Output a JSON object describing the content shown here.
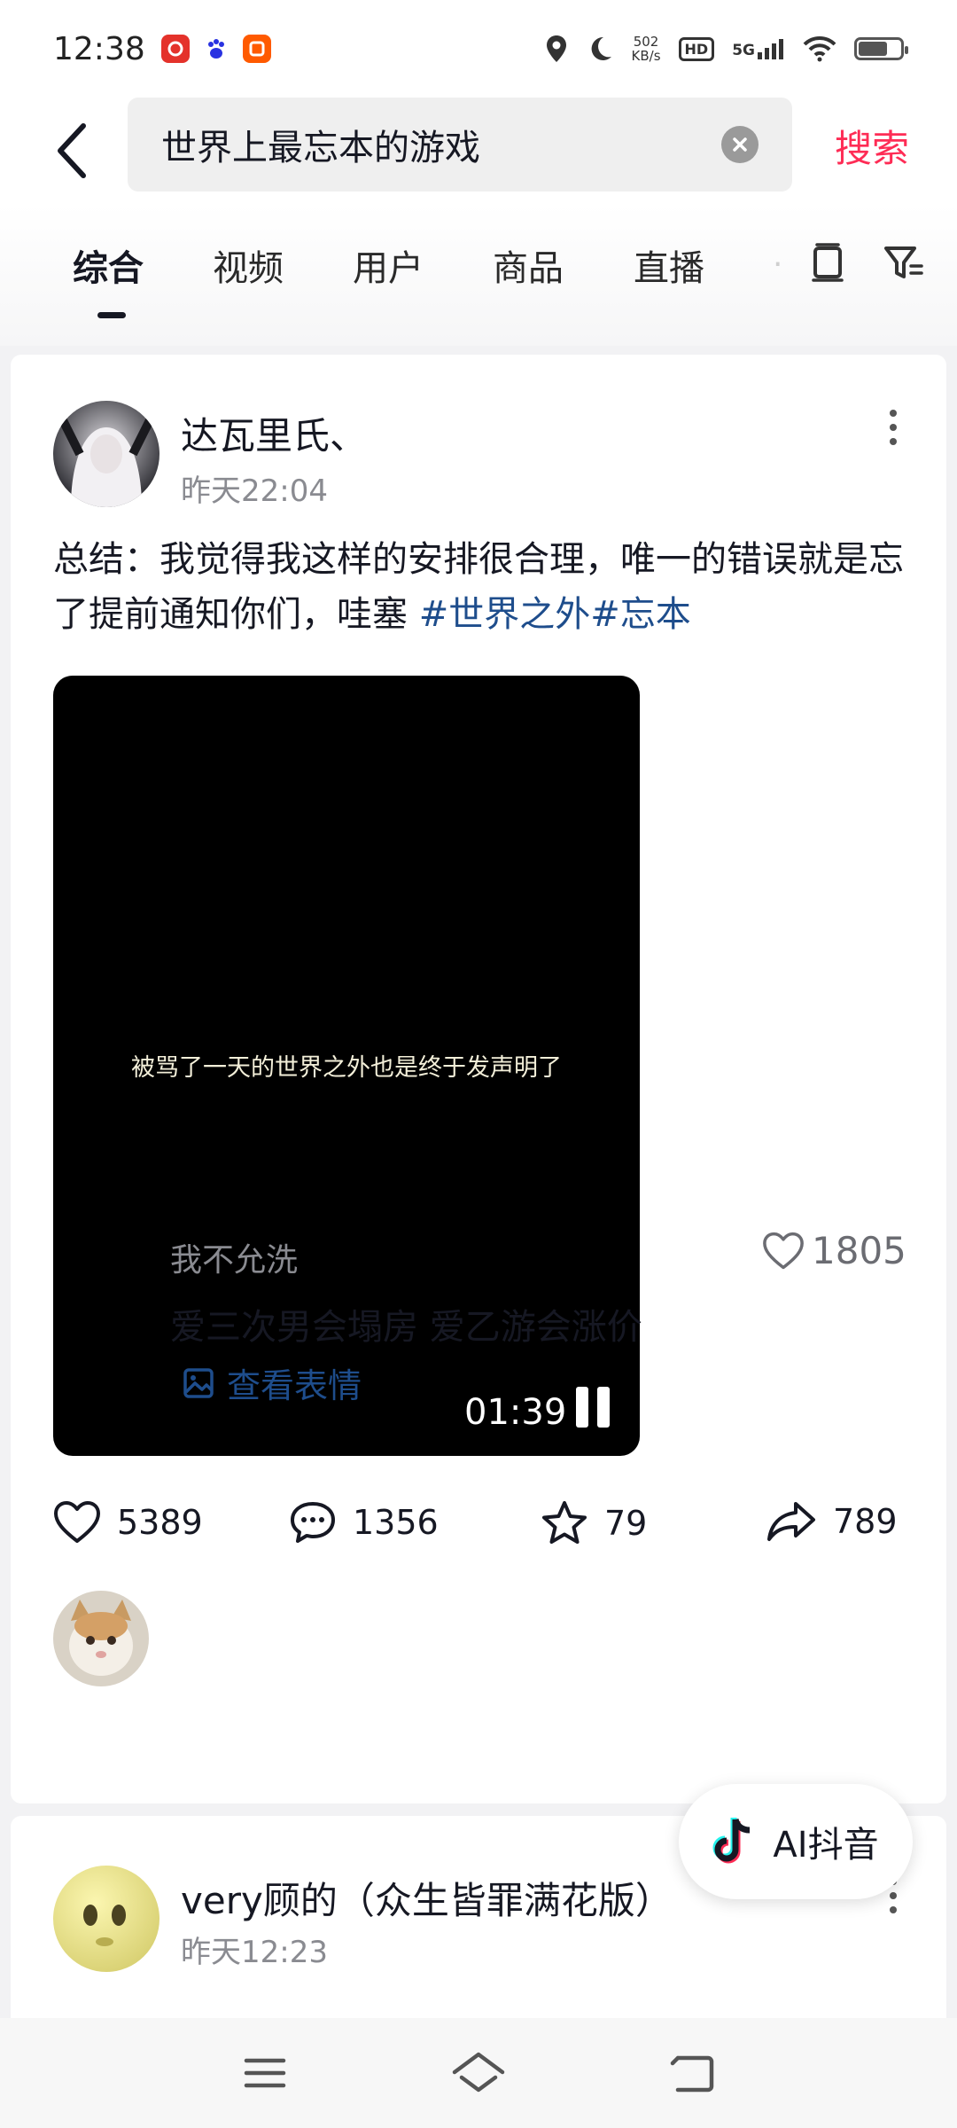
{
  "status_bar": {
    "time": "12:38",
    "net_speed_value": "502",
    "net_speed_unit": "KB/s",
    "hd_badge": "HD",
    "network": "5G",
    "apps": [
      "netease-music-icon",
      "baidu-icon",
      "taobao-icon"
    ]
  },
  "search": {
    "query": "世界上最忘本的游戏",
    "submit_label": "搜索"
  },
  "tabs": [
    {
      "label": "综合",
      "active": true
    },
    {
      "label": "视频"
    },
    {
      "label": "用户"
    },
    {
      "label": "商品"
    },
    {
      "label": "直播"
    }
  ],
  "post1": {
    "author": "达瓦里氏、",
    "time": "昨天22:04",
    "text": "总结：我觉得我这样的安排很合理，唯一的错误就是忘了提前通知你们，哇塞 ",
    "hashtags": "#世界之外#忘本",
    "video": {
      "caption": "被骂了一天的世界之外也是终于发声明了",
      "duration": "01:39"
    },
    "actions": {
      "likes": "5389",
      "comments": "1356",
      "favorites": "79",
      "shares": "789"
    },
    "top_comment": {
      "name": "我不允洗",
      "likes": "1805",
      "text": "爱三次男会塌房 爱乙游会涨价",
      "view_emoji_label": "查看表情"
    }
  },
  "post2": {
    "author": "very顾的（众生皆罪满花版）",
    "time": "昨天12:23"
  },
  "ai_button": {
    "label": "AI抖音"
  },
  "colors": {
    "accent": "#fe2c55",
    "link": "#1e4d8c",
    "text": "#161823",
    "secondary": "#8a8b91"
  }
}
